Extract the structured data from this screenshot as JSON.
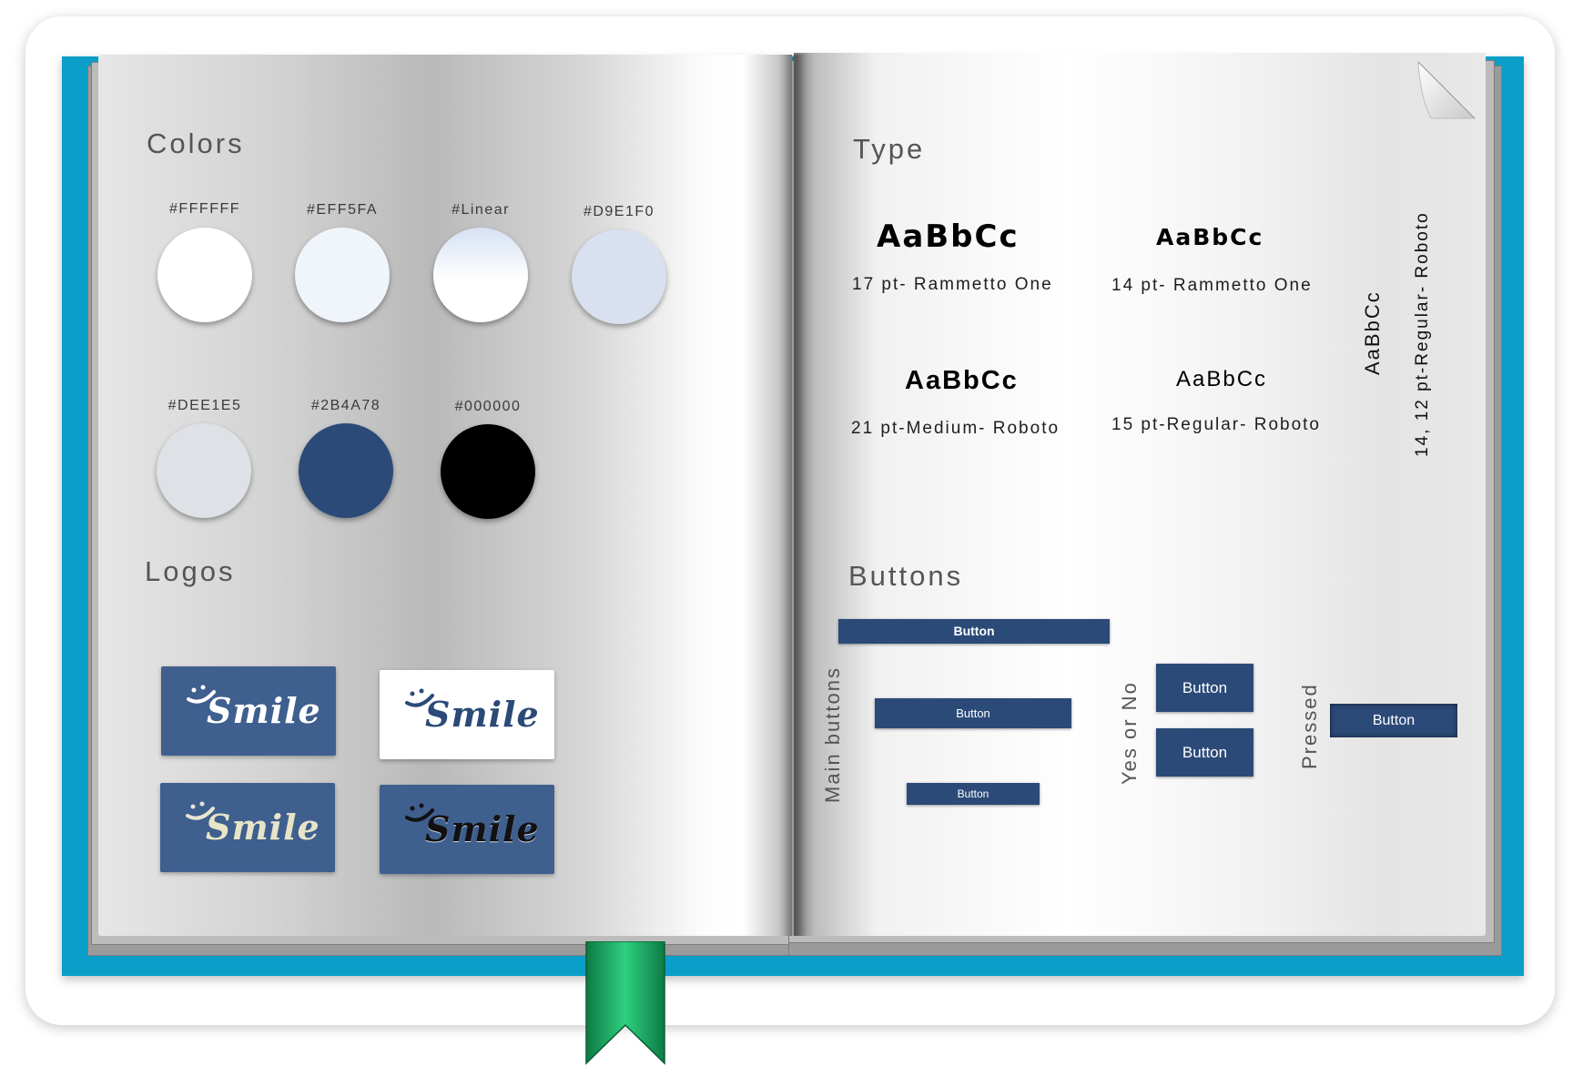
{
  "left_page": {
    "colors_heading": "Colors",
    "colors": [
      {
        "label": "#FFFFFF",
        "hex": "#FFFFFF"
      },
      {
        "label": "#EFF5FA",
        "hex": "#EFF5FA"
      },
      {
        "label": "#Linear",
        "hex": "linear"
      },
      {
        "label": "#D9E1F0",
        "hex": "#D9E1F0"
      },
      {
        "label": "#DEE1E5",
        "hex": "#DEE1E5"
      },
      {
        "label": "#2B4A78",
        "hex": "#2B4A78"
      },
      {
        "label": "#000000",
        "hex": "#000000"
      }
    ],
    "logos_heading": "Logos",
    "logos": [
      {
        "text": "Smile",
        "variant": "white-on-blue"
      },
      {
        "text": "Smile",
        "variant": "blue-on-white"
      },
      {
        "text": "Smile",
        "variant": "gradient-on-blue"
      },
      {
        "text": "Smile",
        "variant": "black-gradient-on-blue"
      }
    ]
  },
  "right_page": {
    "type_heading": "Type",
    "type_samples": [
      {
        "sample": "AaBbCc",
        "caption": "17 pt- Rammetto One"
      },
      {
        "sample": "AaBbCc",
        "caption": "14 pt- Rammetto One"
      },
      {
        "sample": "AaBbCc",
        "caption": "21 pt-Medium- Roboto"
      },
      {
        "sample": "AaBbCc",
        "caption": "15 pt-Regular-  Roboto"
      }
    ],
    "vertical_type": {
      "sample": "AaBbCc",
      "caption": "14, 12 pt-Regular- Roboto"
    },
    "buttons_heading": "Buttons",
    "main_buttons_label": "Main buttons",
    "main_buttons": [
      "Button",
      "Button",
      "Button"
    ],
    "yes_no_label": "Yes or No",
    "yes_no_buttons": [
      "Button",
      "Button"
    ],
    "pressed_label": "Pressed",
    "pressed_button": "Button"
  },
  "colors": {
    "cover": "#0B9EC8",
    "button": "#2B4A78",
    "bookmark": "#1FA463"
  }
}
